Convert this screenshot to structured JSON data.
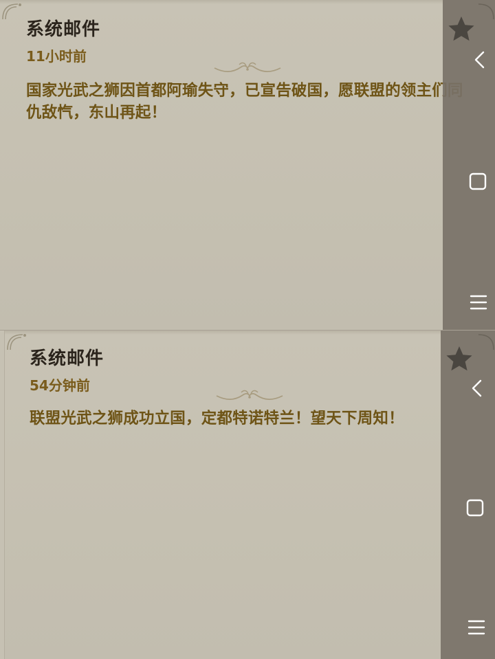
{
  "mails": [
    {
      "title": "系统邮件",
      "time": "11小时前",
      "body": "国家光武之狮因首都阿瑜失守，已宣告破国，愿联盟的领主们同仇敌忾，东山再起！"
    },
    {
      "title": "系统邮件",
      "time": "54分钟前",
      "body": "联盟光武之狮成功立国，定都特诺特兰！望天下周知！"
    }
  ],
  "icons": {
    "favorite": "star-icon",
    "back": "chevron-left-icon",
    "home": "square-icon",
    "menu": "menu-icon"
  },
  "colors": {
    "paper": "#c6c1b3",
    "title": "#2b241c",
    "time": "#7a5c1c",
    "body": "#6e5416",
    "nav_bar": "#787268"
  }
}
